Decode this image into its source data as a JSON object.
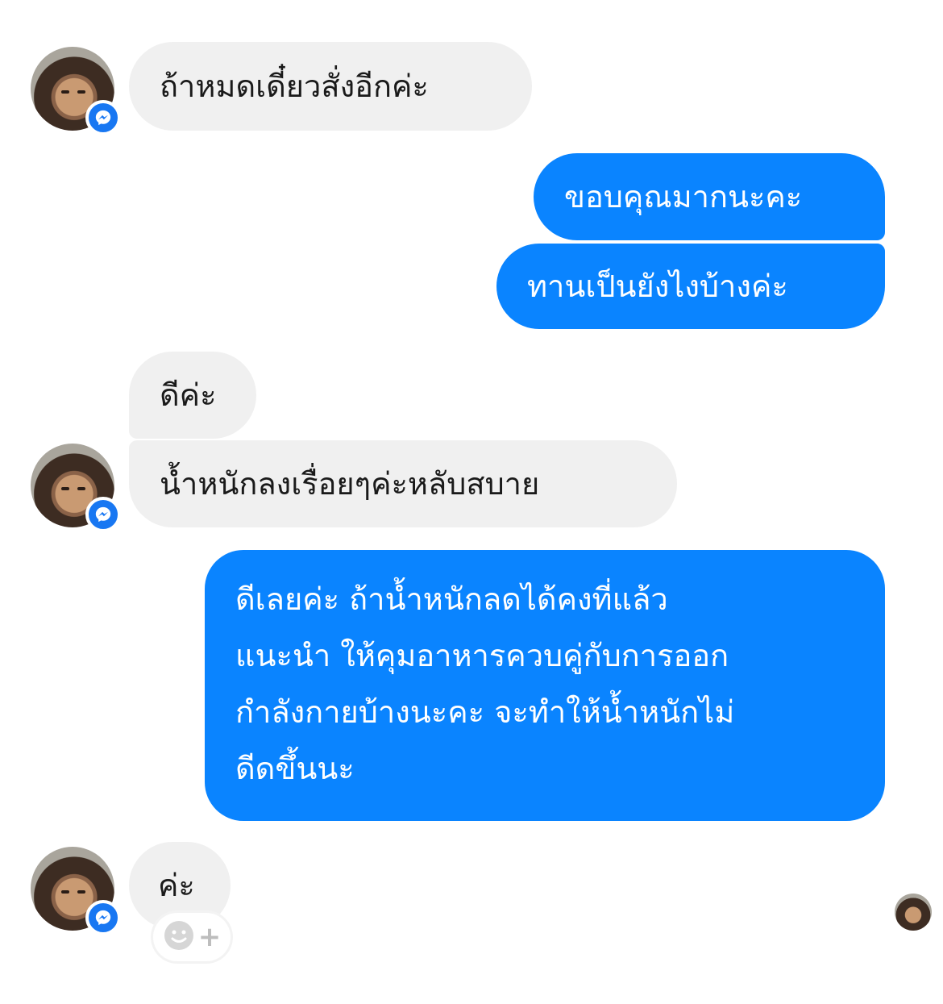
{
  "messages": {
    "m1": "ถ้าหมดเดี๋ยวสั่งอีกค่ะ",
    "m2": "ขอบคุณมากนะคะ",
    "m3": "ทานเป็นยังไงบ้างค่ะ",
    "m4": "ดีค่ะ",
    "m5": "น้ำหนักลงเรื่อยๆค่ะหลับสบาย",
    "m6_lines": [
      "ดีเลยค่ะ ถ้าน้ำหนักลดได้คงที่แล้ว",
      "แนะนำ ให้คุมอาหารควบคู่กับการออก",
      "กำลังกายบ้างนะคะ จะทำให้น้ำหนักไม่",
      "ดีดขึ้นนะ"
    ],
    "m7": "ค่ะ"
  },
  "react_button": {
    "plus": "+",
    "icon": "smiley-icon"
  },
  "colors": {
    "outgoing": "#0a84ff",
    "incoming": "#f0f0f0",
    "badge": "#1877f2"
  },
  "icons": [
    "messenger-icon",
    "smiley-icon"
  ]
}
